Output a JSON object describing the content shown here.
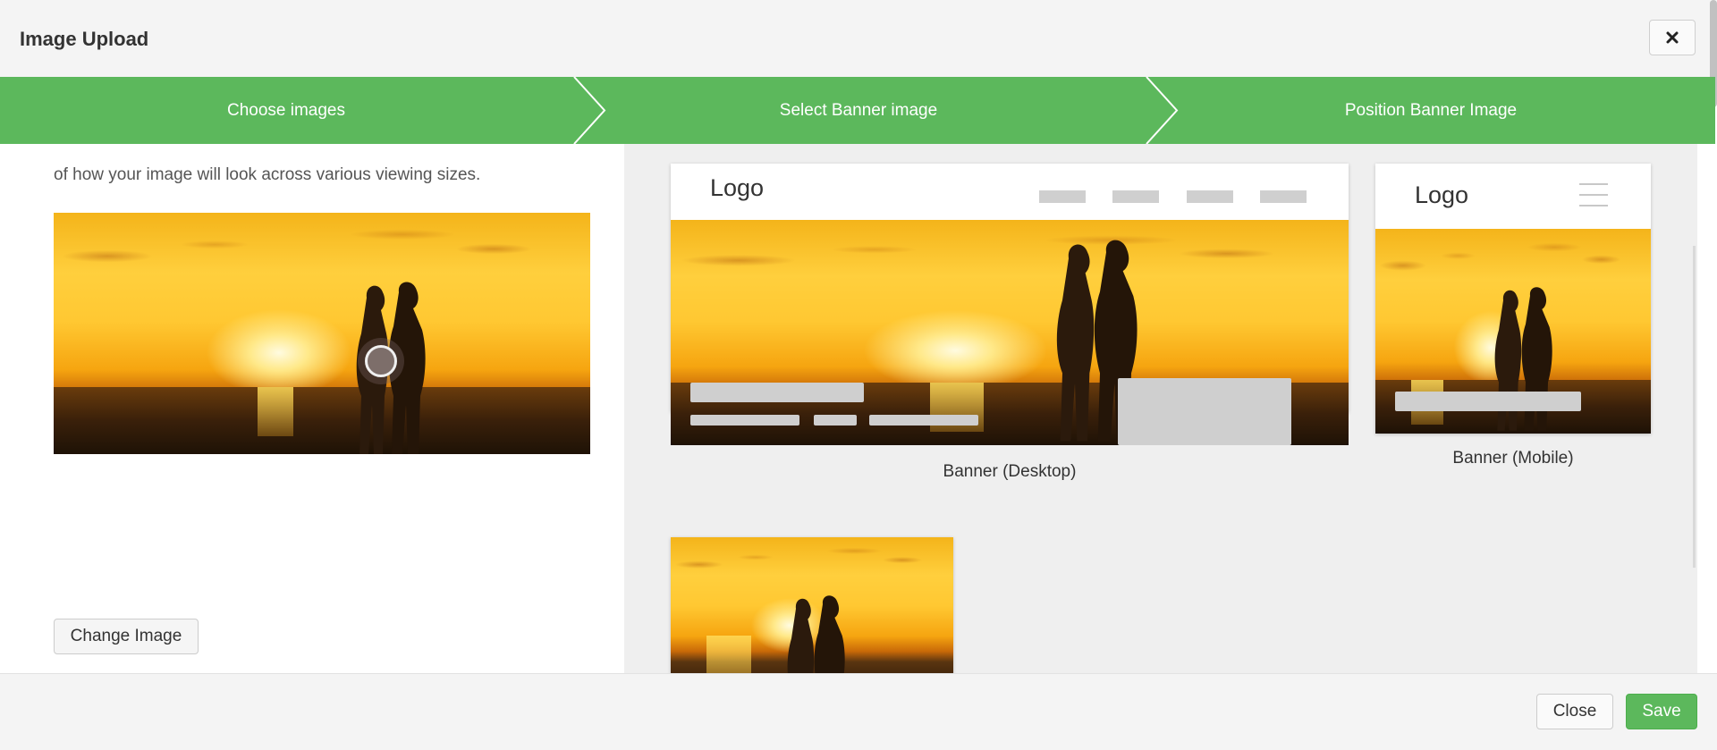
{
  "dialog": {
    "title": "Image Upload",
    "close_icon": "close-icon"
  },
  "steps": [
    {
      "label": "Choose images"
    },
    {
      "label": "Select Banner image"
    },
    {
      "label": "Position Banner Image"
    }
  ],
  "left": {
    "intro_text": "of how your image will look across various viewing sizes.",
    "change_image_label": "Change Image"
  },
  "previews": {
    "desktop": {
      "logo": "Logo",
      "caption": "Banner (Desktop)"
    },
    "mobile": {
      "logo": "Logo",
      "caption": "Banner (Mobile)"
    }
  },
  "footer": {
    "close_label": "Close",
    "save_label": "Save"
  },
  "colors": {
    "accent_green": "#5cb85c",
    "header_bg": "#f4f4f4",
    "preview_bg": "#efefef",
    "placeholder_gray": "#cfcfcf"
  }
}
